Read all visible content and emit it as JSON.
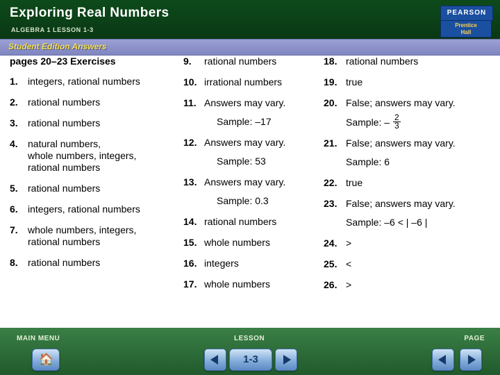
{
  "header": {
    "title": "Exploring Real Numbers",
    "subtitle": "ALGEBRA 1  LESSON 1-3",
    "logo": {
      "brand": "PEARSON",
      "line1": "Prentice",
      "line2": "Hall"
    }
  },
  "banner": {
    "label": "Student Edition Answers"
  },
  "columns": {
    "col1": [
      {
        "num": "",
        "text": "pages 20–23  Exercises",
        "bold": true
      },
      {
        "num": "1.",
        "text": "integers, rational numbers"
      },
      {
        "num": "2.",
        "text": "rational numbers"
      },
      {
        "num": "3.",
        "text": "rational numbers"
      },
      {
        "num": "4.",
        "text": "natural numbers,",
        "text2": "whole numbers, integers,",
        "text3": "rational numbers"
      },
      {
        "num": "5.",
        "text": "rational numbers"
      },
      {
        "num": "6.",
        "text": "integers, rational numbers"
      },
      {
        "num": "7.",
        "text": "whole numbers, integers,",
        "text2": "rational numbers"
      },
      {
        "num": "8.",
        "text": "rational numbers"
      }
    ],
    "col2": [
      {
        "num": "9.",
        "text": "rational numbers"
      },
      {
        "num": "10.",
        "text": "irrational numbers"
      },
      {
        "num": "11.",
        "text": "Answers may vary.",
        "text2": "Sample: –17"
      },
      {
        "num": "12.",
        "text": "Answers may vary.",
        "text2": "Sample: 53"
      },
      {
        "num": "13.",
        "text": "Answers may vary.",
        "text2": "Sample: 0.3"
      },
      {
        "num": "14.",
        "text": "rational numbers"
      },
      {
        "num": "15.",
        "text": "whole numbers"
      },
      {
        "num": "16.",
        "text": "integers"
      },
      {
        "num": "17.",
        "text": "whole numbers"
      }
    ],
    "col3": [
      {
        "num": "18.",
        "text": "rational numbers"
      },
      {
        "num": "19.",
        "text": "true"
      },
      {
        "num": "20.",
        "text": "False; answers may vary.",
        "sample_prefix": "Sample: – ",
        "fraction": {
          "numerator": "2",
          "denominator": "3"
        }
      },
      {
        "num": "21.",
        "text": "False; answers may vary.",
        "text2": "Sample: 6"
      },
      {
        "num": "22.",
        "text": "true"
      },
      {
        "num": "23.",
        "text": "False; answers may vary.",
        "text2": "Sample: –6 < | –6 |"
      },
      {
        "num": "24.",
        "text": ">"
      },
      {
        "num": "25.",
        "text": "<"
      },
      {
        "num": "26.",
        "text": ">"
      }
    ]
  },
  "footer": {
    "main_menu_label": "MAIN MENU",
    "lesson_label": "LESSON",
    "page_label": "PAGE",
    "lesson_number": "1-3",
    "home_icon": "home-icon",
    "prev_icon": "left-arrow-icon",
    "next_icon": "right-arrow-icon"
  },
  "colors": {
    "header_green": "#0b3d16",
    "banner_purple": "#8e93c9",
    "banner_text": "#f4e04a",
    "footer_green": "#2f6f3a",
    "button_blue": "#7fa9d8"
  }
}
